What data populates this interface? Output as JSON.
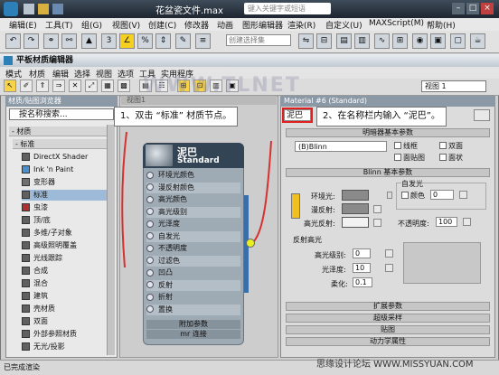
{
  "app": {
    "title": "花盆瓷文件.max",
    "search_placeholder": "键入关键字或短语"
  },
  "main_menu": [
    "编辑(E)",
    "工具(T)",
    "组(G)",
    "视图(V)",
    "创建(C)",
    "修改器",
    "动画",
    "图形编辑器",
    "渲染(R)",
    "自定义(U)",
    "MAXScript(M)",
    "帮助(H)"
  ],
  "toolbar": {
    "selection_set_placeholder": "创建选择集"
  },
  "slate": {
    "title": "平板材质编辑器",
    "menu": [
      "模式",
      "材质",
      "编辑",
      "选择",
      "视图",
      "选项",
      "工具",
      "实用程序"
    ],
    "view_select": "视图 1",
    "view_tab": "视图1"
  },
  "browser": {
    "title": "材质/贴图浏览器",
    "search_placeholder": "按名称搜索...",
    "category": "- 材质",
    "subcategory": "- 标准",
    "items": [
      {
        "label": "DirectX Shader",
        "color": "#606060"
      },
      {
        "label": "Ink 'n Paint",
        "color": "#4a8fd0"
      },
      {
        "label": "变形器",
        "color": "#707070"
      },
      {
        "label": "标准",
        "color": "#606060"
      },
      {
        "label": "虫漆",
        "color": "#b03030"
      },
      {
        "label": "顶/底",
        "color": "#606060"
      },
      {
        "label": "多维/子对象",
        "color": "#606060"
      },
      {
        "label": "高级照明覆盖",
        "color": "#606060"
      },
      {
        "label": "光线跟踪",
        "color": "#606060"
      },
      {
        "label": "合成",
        "color": "#606060"
      },
      {
        "label": "混合",
        "color": "#606060"
      },
      {
        "label": "建筑",
        "color": "#606060"
      },
      {
        "label": "壳材质",
        "color": "#606060"
      },
      {
        "label": "双面",
        "color": "#606060"
      },
      {
        "label": "外部参照材质",
        "color": "#606060"
      },
      {
        "label": "无光/投影",
        "color": "#606060"
      }
    ]
  },
  "node": {
    "name": "泥巴",
    "type": "Standard",
    "slots": [
      "环境光颜色",
      "漫反射颜色",
      "高光颜色",
      "高光级别",
      "光泽度",
      "自发光",
      "不透明度",
      "过滤色",
      "凹凸",
      "反射",
      "折射",
      "置换"
    ],
    "footer1": "附加参数",
    "footer2": "mr 连接"
  },
  "properties": {
    "title": "Material #6 (Standard)",
    "name_value": "泥巴",
    "rollout_basic": "明暗器基本参数",
    "shader": "(B)Blinn",
    "checks": [
      "线框",
      "双面",
      "面贴图",
      "面状"
    ],
    "rollout_blinn": "Blinn 基本参数",
    "self_illum_title": "自发光",
    "color_label": "颜色",
    "color_value": "0",
    "ambient_label": "环境光:",
    "diffuse_label": "漫反射:",
    "specular_label": "高光反射:",
    "opacity_label": "不透明度:",
    "opacity_value": "100",
    "specular_highlights": "反射高光",
    "spec_level_label": "高光级别:",
    "spec_level_value": "0",
    "gloss_label": "光泽度:",
    "gloss_value": "10",
    "soften_label": "柔化:",
    "soften_value": "0.1",
    "rollouts_bottom": [
      "扩展参数",
      "超级采样",
      "贴图",
      "动力学属性"
    ]
  },
  "callouts": {
    "one": "1、双击 “标准” 材质节点。",
    "two": "2、在名称栏内输入 “泥巴”。"
  },
  "status": {
    "text": "已完成渲染"
  },
  "watermarks": {
    "tlnet": "WWW.TLNET",
    "missyuan": "思缘设计论坛 WWW.MISSYUAN.COM"
  }
}
